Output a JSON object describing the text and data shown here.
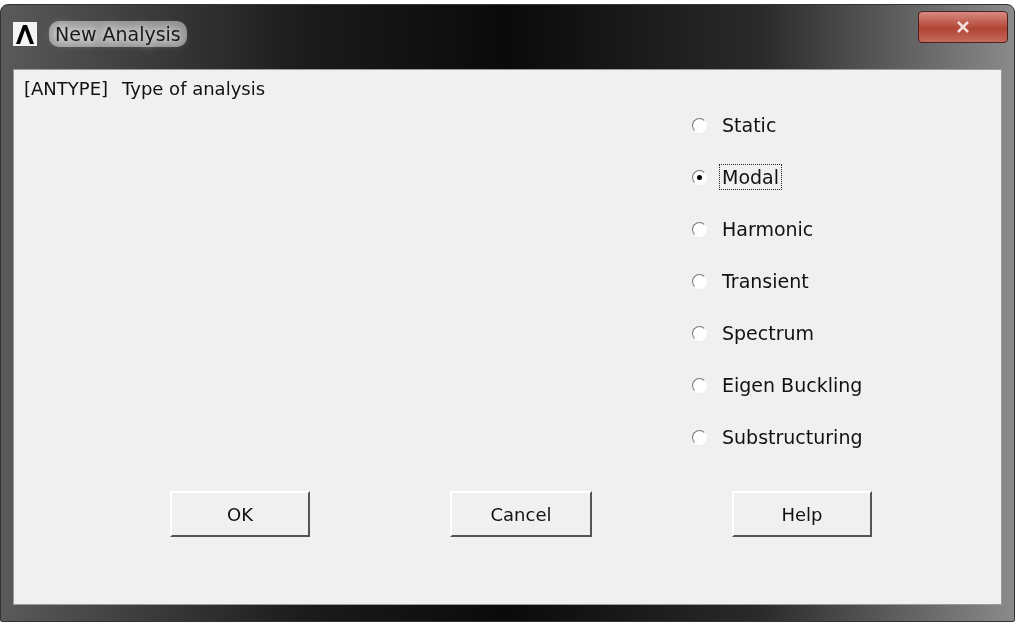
{
  "window": {
    "title": "New Analysis"
  },
  "prompt": {
    "code": "[ANTYPE]",
    "label": "Type of analysis"
  },
  "options": [
    {
      "label": "Static",
      "selected": false
    },
    {
      "label": "Modal",
      "selected": true
    },
    {
      "label": "Harmonic",
      "selected": false
    },
    {
      "label": "Transient",
      "selected": false
    },
    {
      "label": "Spectrum",
      "selected": false
    },
    {
      "label": "Eigen Buckling",
      "selected": false
    },
    {
      "label": "Substructuring",
      "selected": false
    }
  ],
  "buttons": [
    "OK",
    "Cancel",
    "Help"
  ]
}
